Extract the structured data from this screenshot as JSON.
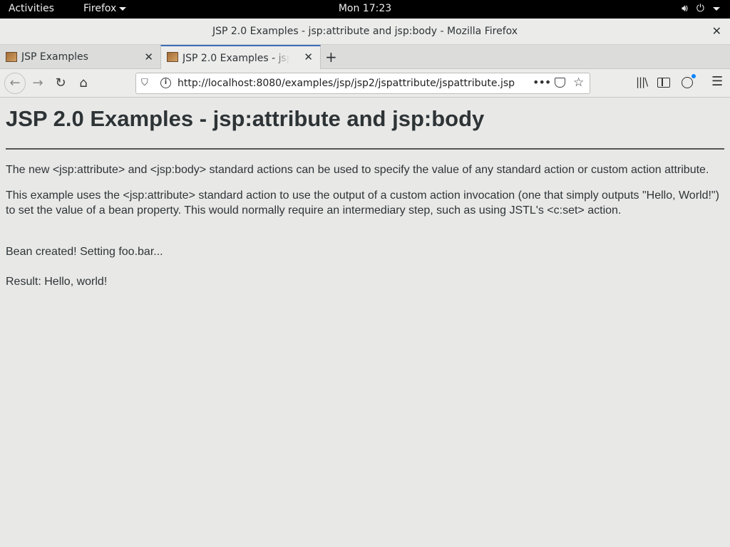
{
  "topbar": {
    "activities": "Activities",
    "app_menu": "Firefox",
    "clock": "Mon 17:23",
    "icons": [
      "volume-icon",
      "power-icon",
      "chevron-down-icon"
    ]
  },
  "window": {
    "title": "JSP 2.0 Examples - jsp:attribute and jsp:body - Mozilla Firefox",
    "close": "✕"
  },
  "tabs": [
    {
      "label": "JSP Examples",
      "active": false
    },
    {
      "label": "JSP 2.0 Examples - jsp:attribute and jsp:body",
      "active": true
    }
  ],
  "newtab": "+",
  "navbar": {
    "url": "http://localhost:8080/examples/jsp/jsp2/jspattribute/jspattribute.jsp",
    "more": "•••"
  },
  "page": {
    "heading": "JSP 2.0 Examples - jsp:attribute and jsp:body",
    "para1": "The new <jsp:attribute> and <jsp:body> standard actions can be used to specify the value of any standard action or custom action attribute.",
    "para2": "This example uses the <jsp:attribute> standard action to use the output of a custom action invocation (one that simply outputs \"Hello, World!\") to set the value of a bean property. This would normally require an intermediary step, such as using JSTL's <c:set> action.",
    "bean_created": "Bean created! Setting foo.bar...",
    "result": "Result: Hello, world!"
  },
  "colors": {
    "page_bg": "#e8e8e7",
    "text": "#2e3436",
    "active_tab_accent": "#3d6fb7",
    "account_badge": "#0a84ff"
  }
}
